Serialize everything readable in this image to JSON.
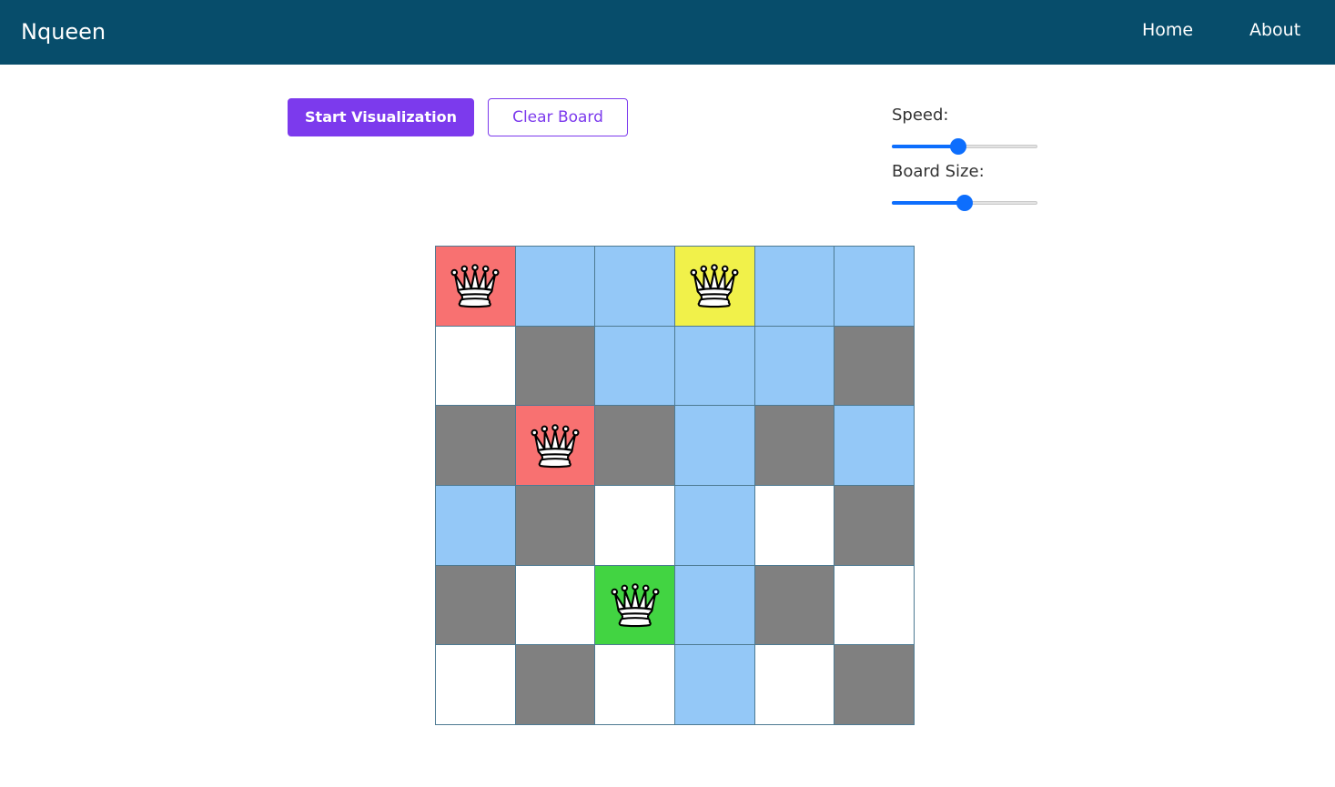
{
  "nav": {
    "brand": "Nqueen",
    "links": [
      {
        "label": "Home"
      },
      {
        "label": "About"
      }
    ]
  },
  "buttons": {
    "start_label": "Start Visualization",
    "clear_label": "Clear Board"
  },
  "controls": {
    "speed_label": "Speed:",
    "speed_value": 0.45,
    "board_size_label": "Board Size:",
    "board_size_value": 0.5
  },
  "colors": {
    "navbar": "#074d6b",
    "accent": "#7c3aed",
    "slider": "#0d6efd",
    "white": "#ffffff",
    "gray": "#808080",
    "blue": "#94c8f7",
    "red": "#f87171",
    "yellow": "#f1f14a",
    "green": "#42d442"
  },
  "board": {
    "size": 6,
    "cells": [
      [
        "red",
        "blue",
        "blue",
        "yellow",
        "blue",
        "blue"
      ],
      [
        "white",
        "gray",
        "blue",
        "blue",
        "blue",
        "gray"
      ],
      [
        "gray",
        "red",
        "gray",
        "blue",
        "gray",
        "blue"
      ],
      [
        "blue",
        "gray",
        "white",
        "blue",
        "white",
        "gray"
      ],
      [
        "gray",
        "white",
        "green",
        "blue",
        "gray",
        "white"
      ],
      [
        "white",
        "gray",
        "white",
        "blue",
        "white",
        "gray"
      ]
    ],
    "queens": [
      {
        "row": 0,
        "col": 0,
        "icon": "queen-icon"
      },
      {
        "row": 0,
        "col": 3,
        "icon": "queen-icon"
      },
      {
        "row": 2,
        "col": 1,
        "icon": "queen-icon"
      },
      {
        "row": 4,
        "col": 2,
        "icon": "queen-icon"
      }
    ]
  }
}
